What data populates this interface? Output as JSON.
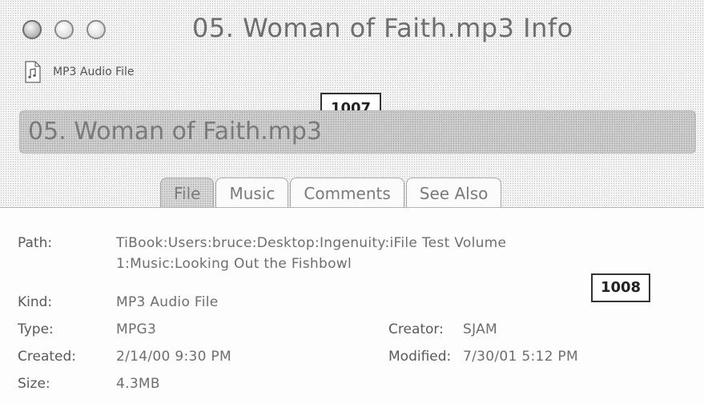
{
  "window": {
    "title": "05. Woman of Faith.mp3 Info",
    "kind_header": "MP3 Audio File",
    "name_value": "05. Woman of Faith.mp3"
  },
  "callouts": {
    "first": "1007",
    "second": "1008"
  },
  "tabs": [
    {
      "label": "File",
      "selected": true
    },
    {
      "label": "Music",
      "selected": false
    },
    {
      "label": "Comments",
      "selected": false
    },
    {
      "label": "See Also",
      "selected": false
    }
  ],
  "file_info": {
    "path_label": "Path:",
    "path_line1": "TiBook:Users:bruce:Desktop:Ingenuity:iFile Test Volume",
    "path_line2": "1:Music:Looking Out the Fishbowl",
    "kind_label": "Kind:",
    "kind_value": "MP3 Audio File",
    "type_label": "Type:",
    "type_value": "MPG3",
    "creator_label": "Creator:",
    "creator_value": "SJAM",
    "created_label": "Created:",
    "created_value": "2/14/00 9:30 PM",
    "modified_label": "Modified:",
    "modified_value": "7/30/01 5:12 PM",
    "size_label": "Size:",
    "size_value": "4.3MB"
  },
  "icons": {
    "window_controls": [
      "close-icon",
      "minimize-icon",
      "zoom-icon"
    ],
    "file_type": "document-icon"
  }
}
